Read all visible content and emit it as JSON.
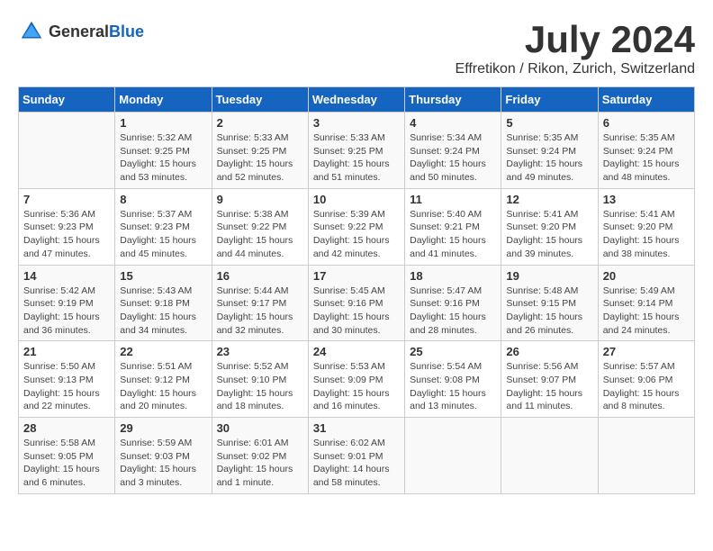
{
  "logo": {
    "text_general": "General",
    "text_blue": "Blue"
  },
  "title": "July 2024",
  "subtitle": "Effretikon / Rikon, Zurich, Switzerland",
  "days_of_week": [
    "Sunday",
    "Monday",
    "Tuesday",
    "Wednesday",
    "Thursday",
    "Friday",
    "Saturday"
  ],
  "weeks": [
    [
      {
        "day": "",
        "info": ""
      },
      {
        "day": "1",
        "info": "Sunrise: 5:32 AM\nSunset: 9:25 PM\nDaylight: 15 hours\nand 53 minutes."
      },
      {
        "day": "2",
        "info": "Sunrise: 5:33 AM\nSunset: 9:25 PM\nDaylight: 15 hours\nand 52 minutes."
      },
      {
        "day": "3",
        "info": "Sunrise: 5:33 AM\nSunset: 9:25 PM\nDaylight: 15 hours\nand 51 minutes."
      },
      {
        "day": "4",
        "info": "Sunrise: 5:34 AM\nSunset: 9:24 PM\nDaylight: 15 hours\nand 50 minutes."
      },
      {
        "day": "5",
        "info": "Sunrise: 5:35 AM\nSunset: 9:24 PM\nDaylight: 15 hours\nand 49 minutes."
      },
      {
        "day": "6",
        "info": "Sunrise: 5:35 AM\nSunset: 9:24 PM\nDaylight: 15 hours\nand 48 minutes."
      }
    ],
    [
      {
        "day": "7",
        "info": "Sunrise: 5:36 AM\nSunset: 9:23 PM\nDaylight: 15 hours\nand 47 minutes."
      },
      {
        "day": "8",
        "info": "Sunrise: 5:37 AM\nSunset: 9:23 PM\nDaylight: 15 hours\nand 45 minutes."
      },
      {
        "day": "9",
        "info": "Sunrise: 5:38 AM\nSunset: 9:22 PM\nDaylight: 15 hours\nand 44 minutes."
      },
      {
        "day": "10",
        "info": "Sunrise: 5:39 AM\nSunset: 9:22 PM\nDaylight: 15 hours\nand 42 minutes."
      },
      {
        "day": "11",
        "info": "Sunrise: 5:40 AM\nSunset: 9:21 PM\nDaylight: 15 hours\nand 41 minutes."
      },
      {
        "day": "12",
        "info": "Sunrise: 5:41 AM\nSunset: 9:20 PM\nDaylight: 15 hours\nand 39 minutes."
      },
      {
        "day": "13",
        "info": "Sunrise: 5:41 AM\nSunset: 9:20 PM\nDaylight: 15 hours\nand 38 minutes."
      }
    ],
    [
      {
        "day": "14",
        "info": "Sunrise: 5:42 AM\nSunset: 9:19 PM\nDaylight: 15 hours\nand 36 minutes."
      },
      {
        "day": "15",
        "info": "Sunrise: 5:43 AM\nSunset: 9:18 PM\nDaylight: 15 hours\nand 34 minutes."
      },
      {
        "day": "16",
        "info": "Sunrise: 5:44 AM\nSunset: 9:17 PM\nDaylight: 15 hours\nand 32 minutes."
      },
      {
        "day": "17",
        "info": "Sunrise: 5:45 AM\nSunset: 9:16 PM\nDaylight: 15 hours\nand 30 minutes."
      },
      {
        "day": "18",
        "info": "Sunrise: 5:47 AM\nSunset: 9:16 PM\nDaylight: 15 hours\nand 28 minutes."
      },
      {
        "day": "19",
        "info": "Sunrise: 5:48 AM\nSunset: 9:15 PM\nDaylight: 15 hours\nand 26 minutes."
      },
      {
        "day": "20",
        "info": "Sunrise: 5:49 AM\nSunset: 9:14 PM\nDaylight: 15 hours\nand 24 minutes."
      }
    ],
    [
      {
        "day": "21",
        "info": "Sunrise: 5:50 AM\nSunset: 9:13 PM\nDaylight: 15 hours\nand 22 minutes."
      },
      {
        "day": "22",
        "info": "Sunrise: 5:51 AM\nSunset: 9:12 PM\nDaylight: 15 hours\nand 20 minutes."
      },
      {
        "day": "23",
        "info": "Sunrise: 5:52 AM\nSunset: 9:10 PM\nDaylight: 15 hours\nand 18 minutes."
      },
      {
        "day": "24",
        "info": "Sunrise: 5:53 AM\nSunset: 9:09 PM\nDaylight: 15 hours\nand 16 minutes."
      },
      {
        "day": "25",
        "info": "Sunrise: 5:54 AM\nSunset: 9:08 PM\nDaylight: 15 hours\nand 13 minutes."
      },
      {
        "day": "26",
        "info": "Sunrise: 5:56 AM\nSunset: 9:07 PM\nDaylight: 15 hours\nand 11 minutes."
      },
      {
        "day": "27",
        "info": "Sunrise: 5:57 AM\nSunset: 9:06 PM\nDaylight: 15 hours\nand 8 minutes."
      }
    ],
    [
      {
        "day": "28",
        "info": "Sunrise: 5:58 AM\nSunset: 9:05 PM\nDaylight: 15 hours\nand 6 minutes."
      },
      {
        "day": "29",
        "info": "Sunrise: 5:59 AM\nSunset: 9:03 PM\nDaylight: 15 hours\nand 3 minutes."
      },
      {
        "day": "30",
        "info": "Sunrise: 6:01 AM\nSunset: 9:02 PM\nDaylight: 15 hours\nand 1 minute."
      },
      {
        "day": "31",
        "info": "Sunrise: 6:02 AM\nSunset: 9:01 PM\nDaylight: 14 hours\nand 58 minutes."
      },
      {
        "day": "",
        "info": ""
      },
      {
        "day": "",
        "info": ""
      },
      {
        "day": "",
        "info": ""
      }
    ]
  ]
}
